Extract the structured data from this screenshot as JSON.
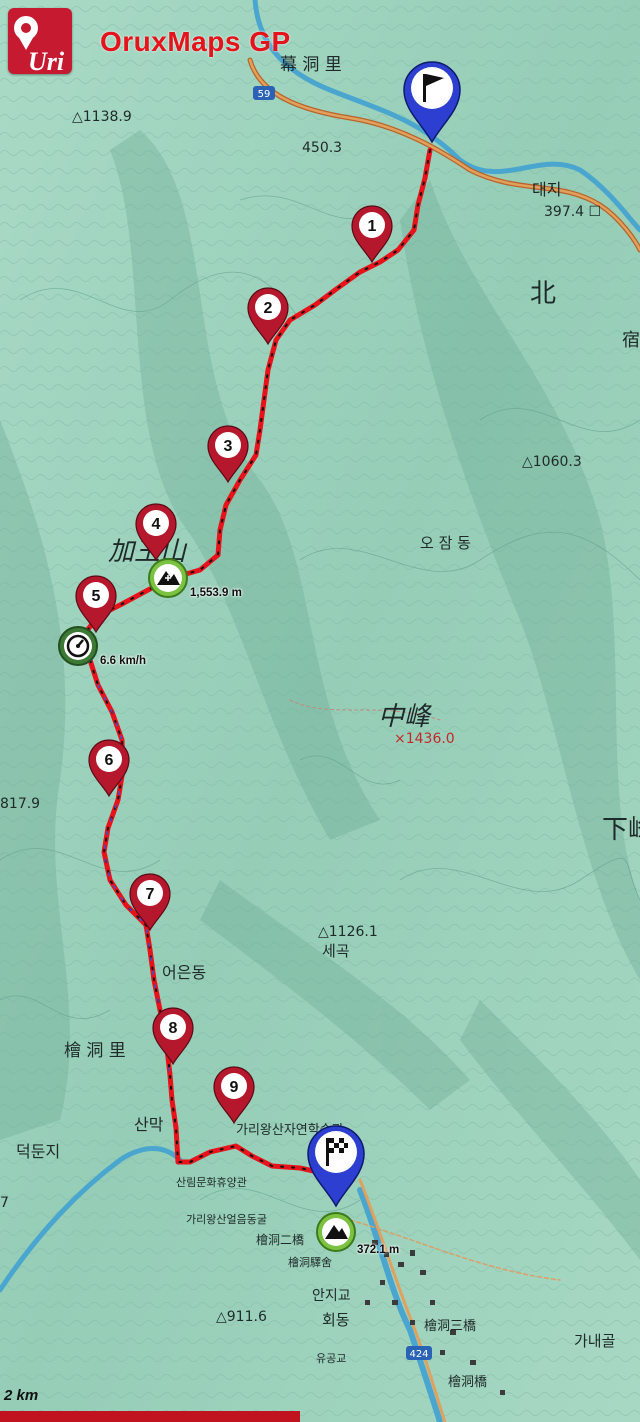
{
  "app": {
    "title": "OruxMaps GP",
    "logo_icon": "oruxmaps-logo-icon"
  },
  "map": {
    "scale_label": "2 km",
    "labels": {
      "village_top": "幕 洞 里",
      "elev_top": "450.3",
      "elev_left": "△1138.9",
      "daeji": "대지",
      "elev_daeji": "397.4 ☐",
      "buk": "北",
      "suk": "宿",
      "elev_1060": "△1060.3",
      "ojamdong": "오 잠 동",
      "gawangsan": "加王山",
      "jungbong": "中峰",
      "elev_1436": "×1436.0",
      "elev_817": "817.9",
      "ha": "下峰",
      "elev_1126": "△1126.1",
      "segok": "세곡",
      "eoeundong": "어은동",
      "hoedong_ri": "檜 洞 里",
      "sanmak": "산막",
      "deokdunji": "덕둔지",
      "nature_center": "가리왕산자연학습관",
      "forest_hall": "산림문화휴양관",
      "gariwangsan_ice": "가리왕산얼음동굴",
      "hoedong_bridge2": "檜洞二橋",
      "hoedong_ni": "檜洞驛舍",
      "anjigyo": "안지교",
      "hoedong": "회동",
      "hoedong_bridge3": "檜洞三橋",
      "elev_911": "△911.6",
      "elev_bottom": "유공교",
      "gaenaegol": "가내골",
      "hoedong_bridge": "檜洞橋",
      "road_59": "59",
      "road_424": "424",
      "seventeen": "7"
    }
  },
  "waypoints": [
    {
      "number": "1",
      "icon": "waypoint-marker-icon"
    },
    {
      "number": "2",
      "icon": "waypoint-marker-icon"
    },
    {
      "number": "3",
      "icon": "waypoint-marker-icon"
    },
    {
      "number": "4",
      "icon": "waypoint-marker-icon"
    },
    {
      "number": "5",
      "icon": "waypoint-marker-icon"
    },
    {
      "number": "6",
      "icon": "waypoint-marker-icon"
    },
    {
      "number": "7",
      "icon": "waypoint-marker-icon"
    },
    {
      "number": "8",
      "icon": "waypoint-marker-icon"
    },
    {
      "number": "9",
      "icon": "waypoint-marker-icon"
    }
  ],
  "markers": {
    "start_icon": "start-flag-icon",
    "finish_icon": "finish-checkered-flag-icon",
    "max_elevation": {
      "icon": "mountain-peak-icon",
      "text": "1,553.9 m"
    },
    "max_speed": {
      "icon": "speedometer-icon",
      "text": "6.6 km/h"
    },
    "min_elevation": {
      "icon": "mountain-peak-icon",
      "text": "372.1 m"
    }
  },
  "colors": {
    "route": "#e8131a",
    "waypoint_pin": "#b5172c",
    "start_finish_pin": "#2c3fd1",
    "stat_badge": "#7cc242",
    "app_title": "#e3141c"
  }
}
